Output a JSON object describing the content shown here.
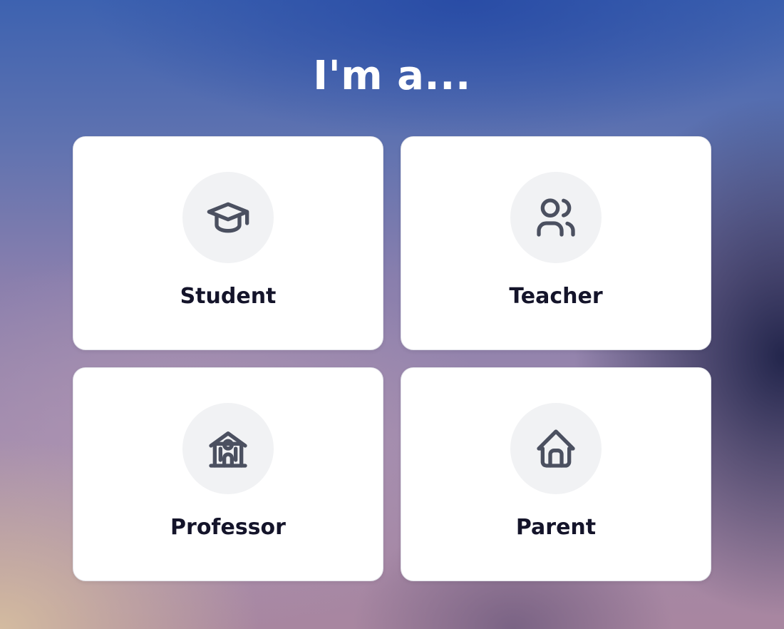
{
  "page": {
    "title": "I'm a..."
  },
  "roles": [
    {
      "label": "Student",
      "icon": "graduation-cap-icon"
    },
    {
      "label": "Teacher",
      "icon": "users-icon"
    },
    {
      "label": "Professor",
      "icon": "school-building-icon"
    },
    {
      "label": "Parent",
      "icon": "home-icon"
    }
  ],
  "colors": {
    "card_background": "#ffffff",
    "icon_circle_background": "#f1f2f4",
    "icon_stroke": "#4b5060",
    "label_text": "#14142a",
    "title_text": "#ffffff"
  }
}
